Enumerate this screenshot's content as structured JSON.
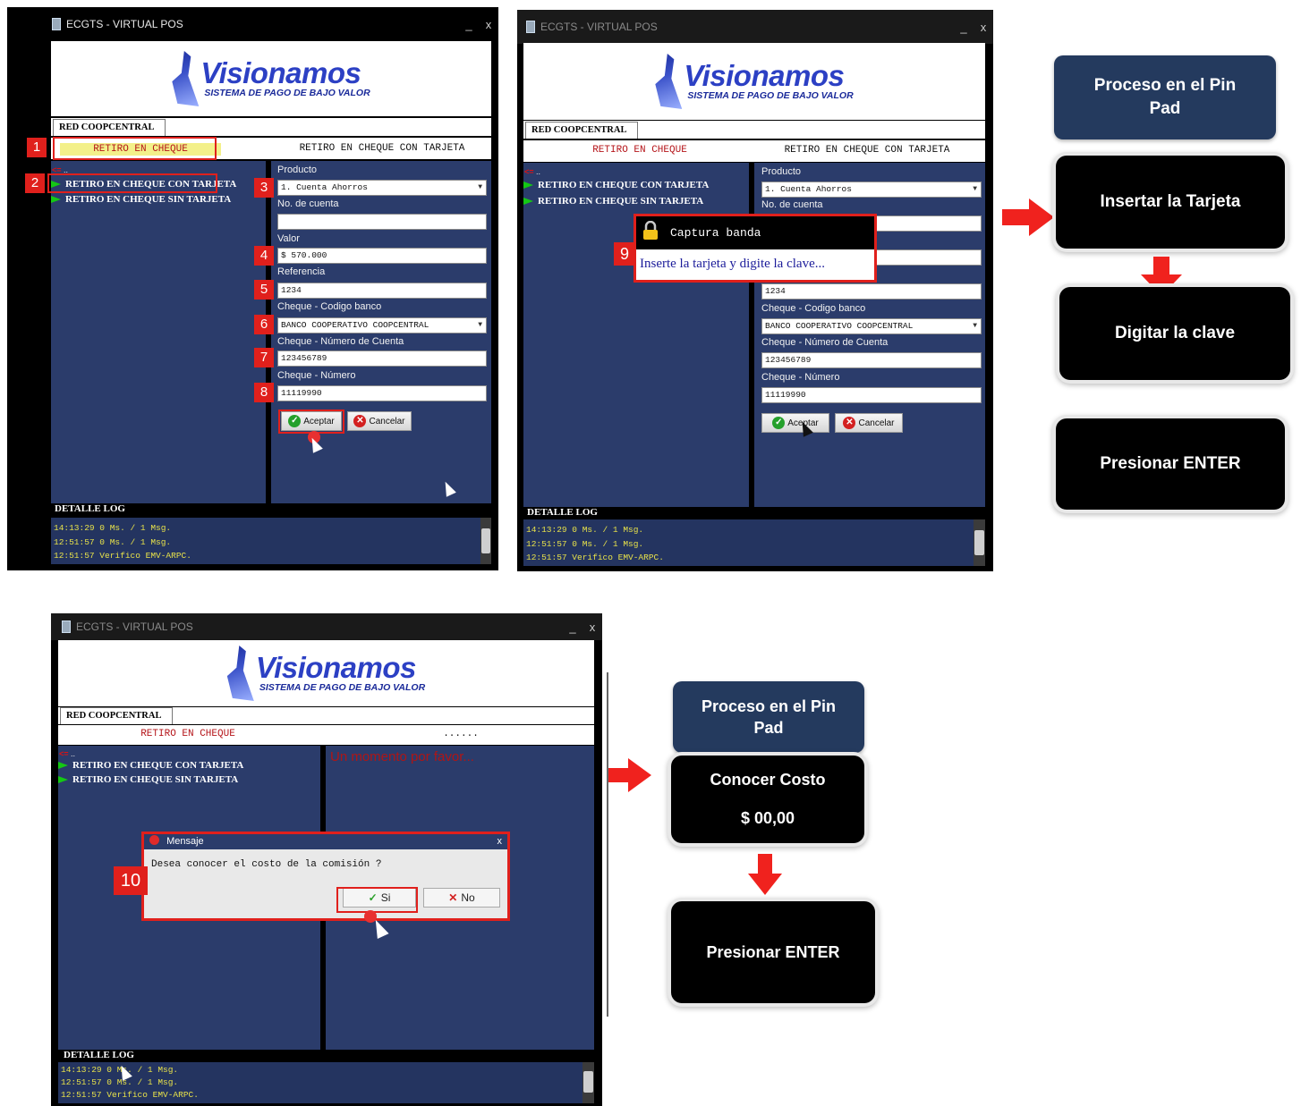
{
  "window": {
    "title": "ECGTS - VIRTUAL POS",
    "minimize": "_",
    "close": "x"
  },
  "logo": {
    "name": "Visionamos",
    "tagline": "SISTEMA DE PAGO DE BAJO VALOR"
  },
  "tab": "RED COOPCENTRAL",
  "header": {
    "left": "RETIRO EN CHEQUE",
    "right": "RETIRO EN CHEQUE CON TARJETA",
    "right_dots": "......"
  },
  "menu": {
    "back": "..",
    "items": [
      "RETIRO EN CHEQUE CON TARJETA",
      "RETIRO EN CHEQUE SIN TARJETA"
    ]
  },
  "form": {
    "producto_label": "Producto",
    "producto_value": "1. Cuenta Ahorros",
    "cuenta_label": "No. de cuenta",
    "cuenta_value": "",
    "valor_label": "Valor",
    "valor_value": "$ 570.000",
    "referencia_label": "Referencia",
    "referencia_value": "1234",
    "banco_label": "Cheque - Codigo banco",
    "banco_value": "BANCO COOPERATIVO COOPCENTRAL",
    "numcuenta_label": "Cheque - Número de Cuenta",
    "numcuenta_value": "123456789",
    "numero_label": "Cheque - Número",
    "numero_value": "11119990",
    "aceptar": "Aceptar",
    "cancelar": "Cancelar"
  },
  "log": {
    "title": "DETALLE LOG",
    "lines": [
      "14:13:29 0 Ms. / 1 Msg.",
      "12:51:57 0 Ms. / 1 Msg.",
      "12:51:57 Verifico EMV-ARPC."
    ]
  },
  "steps": [
    "1",
    "2",
    "3",
    "4",
    "5",
    "6",
    "7",
    "8",
    "9",
    "10"
  ],
  "popup": {
    "title": "Captura banda",
    "message": "Inserte la tarjeta y digite la clave..."
  },
  "wait_message": "Un momento por favor...",
  "dialog": {
    "title": "Mensaje",
    "message": "Desea conocer el costo de la comisión ?",
    "si": "Si",
    "no": "No",
    "close": "x"
  },
  "pinpad1": {
    "header": "Proceso en el Pin Pad",
    "steps": [
      "Insertar la Tarjeta",
      "Digitar la clave",
      "Presionar ENTER"
    ]
  },
  "pinpad2": {
    "header": "Proceso en el Pin Pad",
    "cost_title": "Conocer Costo",
    "cost_value": "$ 00,00",
    "enter": "Presionar ENTER"
  },
  "colors": {
    "navy": "#2b3c6b",
    "red_highlight": "#e0201c",
    "log_text": "#e8e24a",
    "pinpad_header": "#243a5e"
  }
}
